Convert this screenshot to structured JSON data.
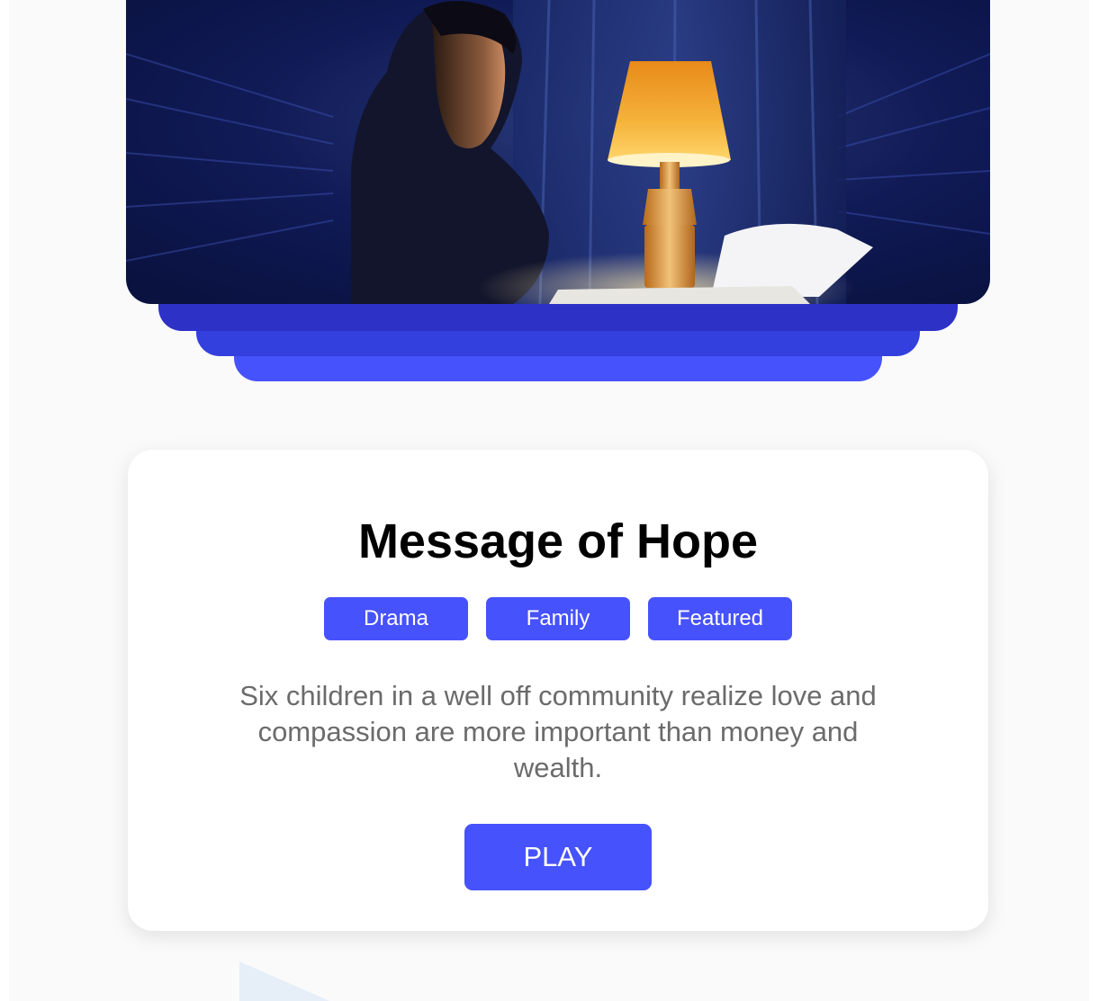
{
  "colors": {
    "accent": "#4652fb",
    "stack_top": "#2d31c6",
    "stack_mid": "#3440dd",
    "stack_bottom": "#4652fb",
    "description_text": "#6b6b6b"
  },
  "hero": {
    "image_name": "man-at-desk-with-lamp"
  },
  "card": {
    "title": "Message of Hope",
    "tags": [
      "Drama",
      "Family",
      "Featured"
    ],
    "description": "Six children in a well off community realize love and compassion are more important than money and wealth.",
    "play_label": "PLAY"
  }
}
